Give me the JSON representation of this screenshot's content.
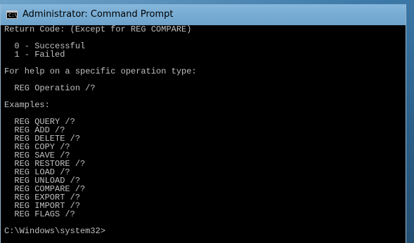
{
  "window": {
    "title": "Administrator: Command Prompt",
    "icon_label": "C:\\"
  },
  "console": {
    "lines": [
      "Return Code: (Except for REG COMPARE)",
      "",
      "  0 - Successful",
      "  1 - Failed",
      "",
      "For help on a specific operation type:",
      "",
      "  REG Operation /?",
      "",
      "Examples:",
      "",
      "  REG QUERY /?",
      "  REG ADD /?",
      "  REG DELETE /?",
      "  REG COPY /?",
      "  REG SAVE /?",
      "  REG RESTORE /?",
      "  REG LOAD /?",
      "  REG UNLOAD /?",
      "  REG COMPARE /?",
      "  REG EXPORT /?",
      "  REG IMPORT /?",
      "  REG FLAGS /?",
      "",
      "C:\\Windows\\system32>"
    ]
  },
  "colors": {
    "console_background": "#000000",
    "console_text": "#c0c0c0",
    "titlebar": "#78acd3"
  },
  "icons": {
    "window_icon": "cmd-icon"
  }
}
